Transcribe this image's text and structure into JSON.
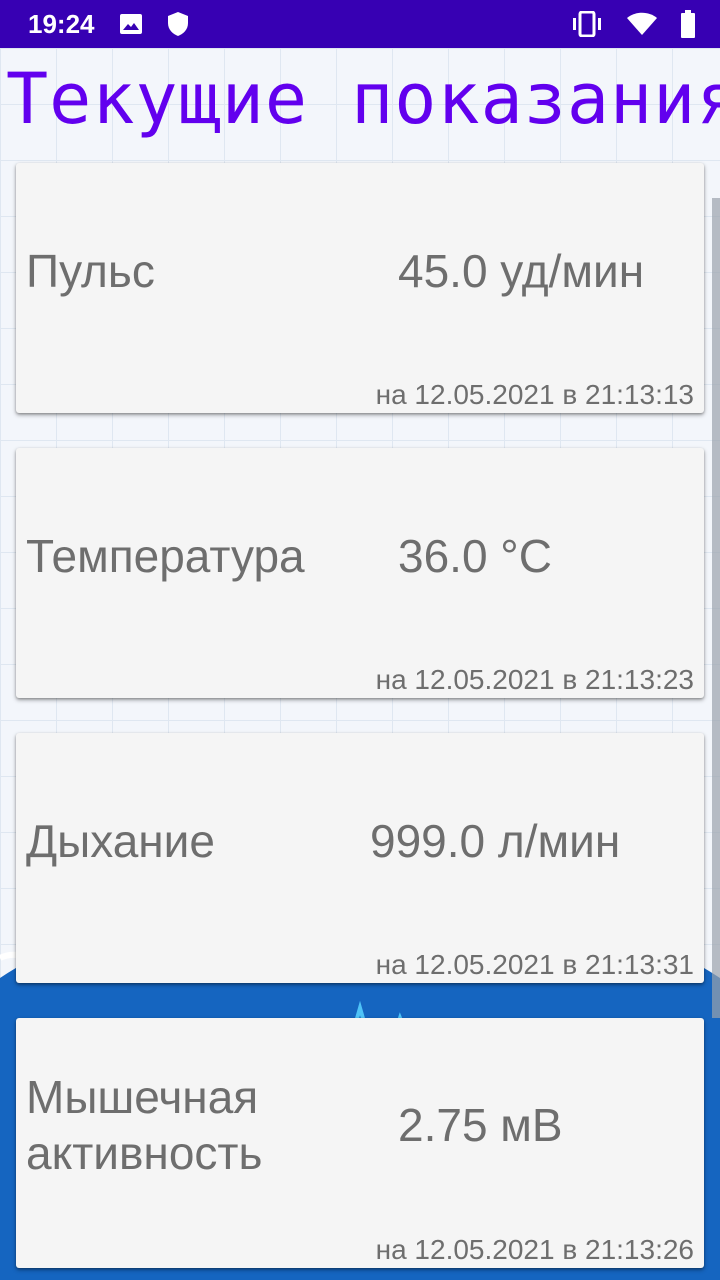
{
  "status_bar": {
    "time": "19:24",
    "icons": [
      "image-icon",
      "shield-icon",
      "vibrate-icon",
      "wifi-icon",
      "battery-icon"
    ]
  },
  "title": "Текущие показания",
  "colors": {
    "accent": "#6200ee",
    "status_bar": "#3700b3",
    "card": "#f5f5f5",
    "text": "#6e6e6e"
  },
  "readings": [
    {
      "label": "Пульс",
      "value": "45.0 уд/мин",
      "time": "на 12.05.2021 в 21:13:13"
    },
    {
      "label": "Температура",
      "value": "36.0 °C",
      "time": "на 12.05.2021 в 21:13:23"
    },
    {
      "label": "Дыхание",
      "value": "999.0 л/мин",
      "time": "на 12.05.2021 в 21:13:31"
    },
    {
      "label": "Мышечная\nактивность",
      "label_line1": "Мышечная",
      "label_line2": "активность",
      "value": "2.75 мВ",
      "time": "на 12.05.2021 в 21:13:26"
    }
  ]
}
